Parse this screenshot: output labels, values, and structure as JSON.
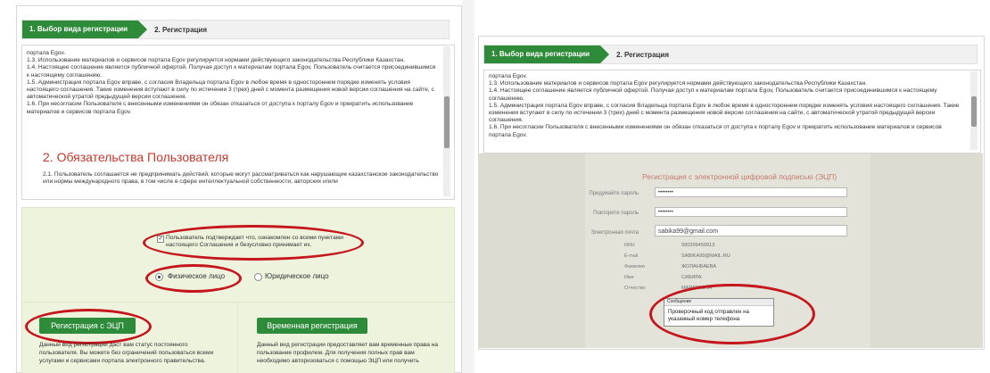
{
  "steps": {
    "step1": "1. Выбор вида регистрации",
    "step2": "2. Регистрация"
  },
  "agreement_text": [
    "портала Egov.",
    "1.3. Использование материалов и сервисов портала Egov регулируется нормами действующего законодательства Республики Казахстан.",
    "1.4. Настоящее соглашение является публичной офертой. Получая доступ к материалам портала Egov, Пользователь считается присоединившимся к настоящему соглашению.",
    "1.5. Администрация портала Egov вправе, с согласия Владельца портала Egov в любое время в одностороннем порядке изменять условия настоящего соглашения. Такие изменения вступают в силу по истечении 3 (трех) дней с момента размещения новой версии соглашения на сайте, с автоматической утратой предыдущей версии соглашения.",
    "1.6. При несогласии Пользователя с внесенными изменениями он обязан отказаться от доступа к порталу Egov и прекратить использование материалов и сервисов портала Egov."
  ],
  "section2_title": "2. Обязательства Пользователя",
  "section2_text": "2.1. Пользователь соглашается не предпринимать действий, которые могут рассматриваться как нарушающие казахстанское законодательство или нормы международного права, в том числе в сфере интеллектуальной собственности, авторских и/или",
  "confirm": {
    "line1": "Пользователь подтверждает что, ознакомлен со всеми пунктами",
    "line2": "настоящего Соглашения и безусловно принимает их."
  },
  "person_type": {
    "physical": "Физическое лицо",
    "legal": "Юридическое лицо"
  },
  "registration": {
    "eds_button": "Регистрация с ЭЦП",
    "eds_desc": "Данный вид регистрации даст вам статус постоянного пользователя. Вы можете без ограничений пользоваться всеми услугами и сервисами портала электронного правительства.",
    "temp_button": "Временная регистрация",
    "temp_desc": "Данный вид регистрации предоставляет вам временные права на пользование профилем. Для получения полных прав вам необходимо авторизоваться с помощью ЭЦП или получить"
  },
  "form": {
    "title": "Регистрация с электронной цифровой подписью (ЭЦП)",
    "password_label": "Придумайте пароль",
    "password_value": "••••••••",
    "repeat_label": "Повторите пароль",
    "repeat_value": "••••••••",
    "email_label": "Электронная почта",
    "email_value": "sabika99@gmail.com",
    "info_rows": [
      {
        "label": "ИИН",
        "value": "990209450913"
      },
      {
        "label": "E-mail",
        "value": "SABIKA99@MAIL.RU"
      },
      {
        "label": "Фамилия",
        "value": "ЖОЛАНБАЕВА"
      },
      {
        "label": "Имя",
        "value": "САБИРА"
      },
      {
        "label": "Отчество",
        "value": "МАРАТОВНА"
      }
    ],
    "message_header": "Сообщение",
    "message_text": "Проверочный код отправлен на указанный номер телефона"
  },
  "colors": {
    "brand_green": "#2e8b3a",
    "heading_red": "#c0392b",
    "annotation_red": "#c4161c"
  }
}
